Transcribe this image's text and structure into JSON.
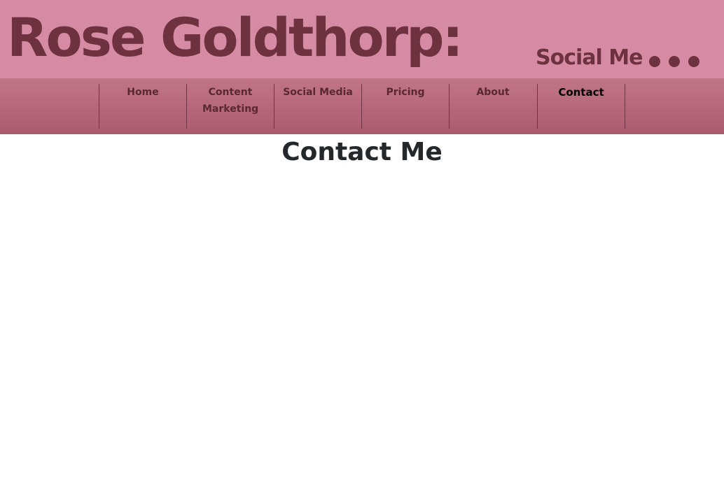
{
  "header": {
    "title": "Rose Goldthorp:",
    "subtitle": "Social Me",
    "brand_color": "#d68ba5",
    "text_color": "#6e313f"
  },
  "nav": {
    "items": [
      {
        "label": "Home"
      },
      {
        "label": "Content Marketing"
      },
      {
        "label": "Social Media"
      },
      {
        "label": "Pricing"
      },
      {
        "label": "About"
      },
      {
        "label": "Contact",
        "active": true
      }
    ]
  },
  "main": {
    "title": "Contact Me"
  }
}
